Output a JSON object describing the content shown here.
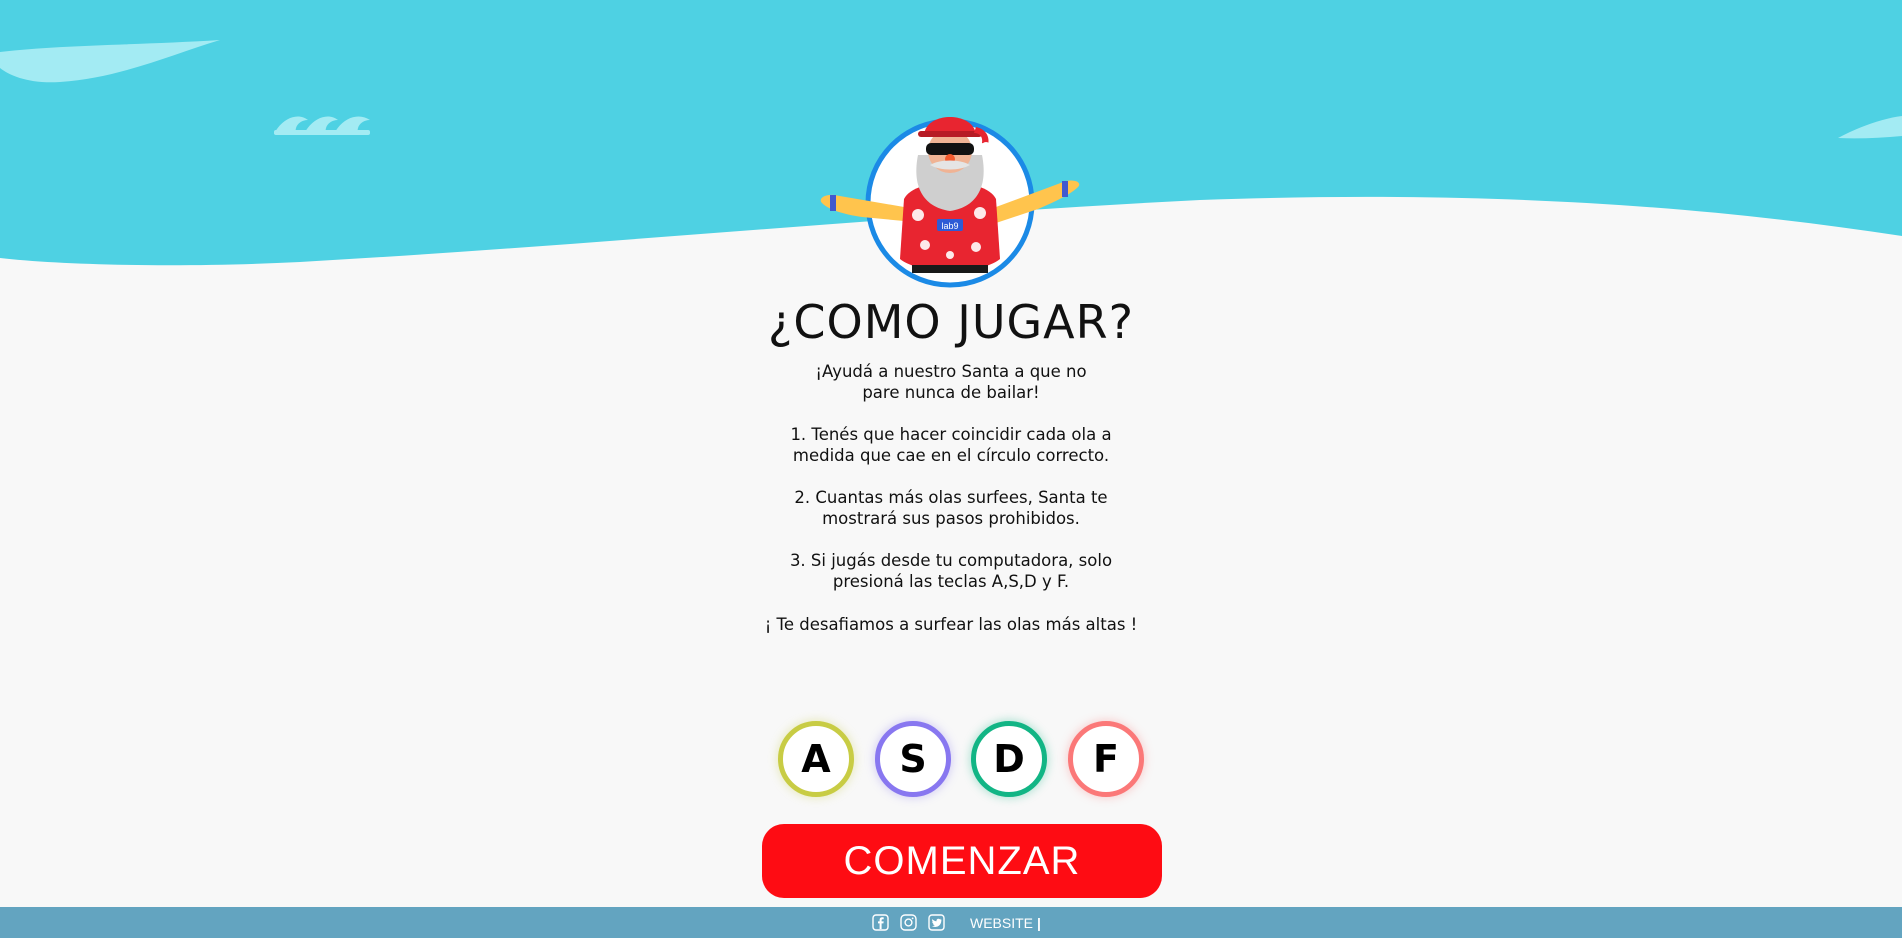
{
  "page": {
    "title": "¿COMO JUGAR?",
    "intro": "¡Ayudá a nuestro Santa a que no pare nunca de bailar!",
    "steps": [
      "1.   Tenés que hacer coincidir cada ola a medida que cae en el círculo correcto.",
      "2.  Cuantas más olas surfees, Santa te mostrará sus pasos prohibidos.",
      "3. Si jugás desde tu computadora, solo presioná las teclas A,S,D y F."
    ],
    "challenge": "¡ Te desafiamos a surfear las olas más altas !"
  },
  "mascot": {
    "badge": "lab9",
    "icon": "santa-surfer-mascot"
  },
  "keys": [
    {
      "label": "A",
      "color": "#c8cc44"
    },
    {
      "label": "S",
      "color": "#8877f0"
    },
    {
      "label": "D",
      "color": "#12b585"
    },
    {
      "label": "F",
      "color": "#fb7878"
    }
  ],
  "start_button": {
    "label": "COMENZAR",
    "color": "#fe0c13"
  },
  "footer": {
    "social_icons": [
      "facebook-icon",
      "instagram-icon",
      "twitter-icon"
    ],
    "website_label": "WEBSITE",
    "separator": "|",
    "background": "#63a4c0"
  },
  "colors": {
    "sky": "#4ed1e3",
    "ground": "#f8f8f8",
    "accent": "#fe0c13"
  }
}
